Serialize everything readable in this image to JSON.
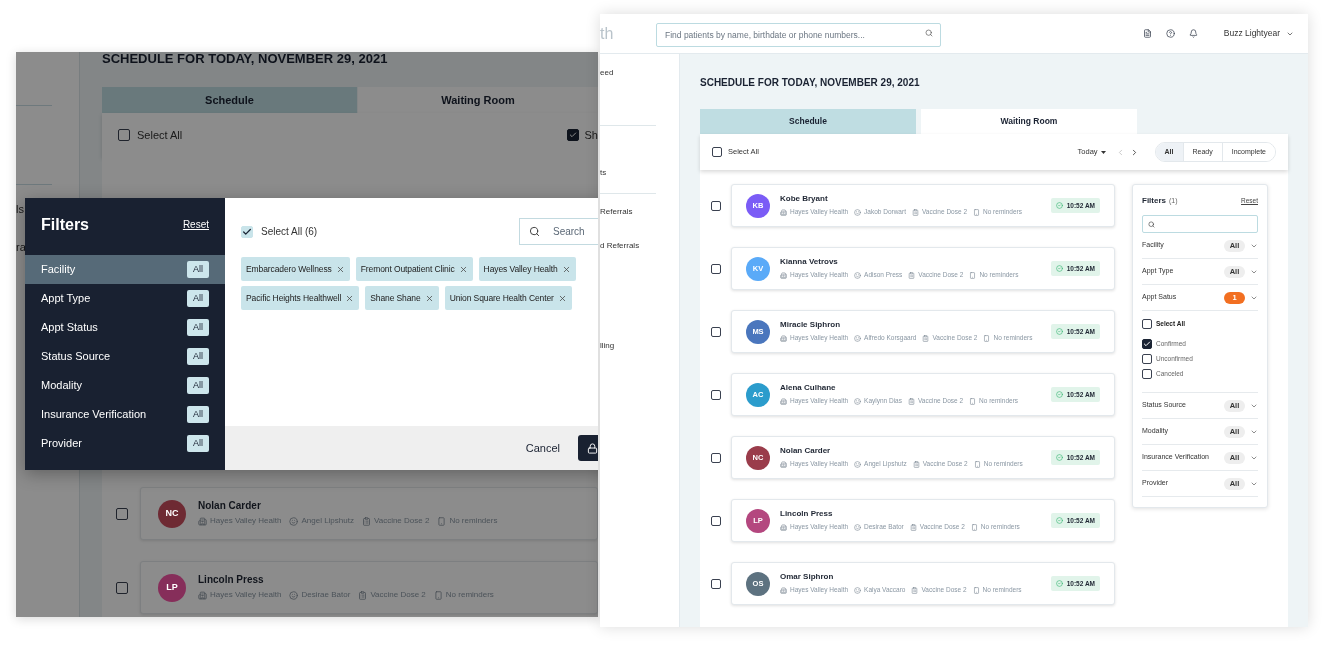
{
  "back_screen": {
    "sidebar_items": [
      "ls",
      "ra"
    ],
    "title": "SCHEDULE FOR TODAY, NOVEMBER 29, 2021",
    "tabs": [
      {
        "label": "Schedule",
        "selected": true
      },
      {
        "label": "Waiting Room",
        "selected": false
      }
    ],
    "select_all": {
      "label": "Select All",
      "checked": false
    },
    "show_toggle": {
      "label": "Sh",
      "checked": true
    },
    "appointments": [
      {
        "initials": "NC",
        "name": "Nolan Carder",
        "color": "#6e2a33",
        "checked": false,
        "facility": "Hayes Valley Health",
        "provider": "Angel Lipshutz",
        "type": "Vaccine Dose 2",
        "reminders": "No reminders"
      },
      {
        "initials": "LP",
        "name": "Lincoln Press",
        "color": "#862e5a",
        "checked": false,
        "facility": "Hayes Valley Health",
        "provider": "Desirae Bator",
        "type": "Vaccine Dose 2",
        "reminders": "No reminders"
      }
    ]
  },
  "filter_modal": {
    "title": "Filters",
    "reset": "Reset",
    "categories": [
      {
        "label": "Facility",
        "badge": "All",
        "selected": true
      },
      {
        "label": "Appt Type",
        "badge": "All",
        "selected": false
      },
      {
        "label": "Appt Status",
        "badge": "All",
        "selected": false
      },
      {
        "label": "Status Source",
        "badge": "All",
        "selected": false
      },
      {
        "label": "Modality",
        "badge": "All",
        "selected": false
      },
      {
        "label": "Insurance Verification",
        "badge": "All",
        "selected": false
      },
      {
        "label": "Provider",
        "badge": "All",
        "selected": false
      }
    ],
    "select_all": {
      "label": "Select All (6)",
      "checked": true
    },
    "search": {
      "placeholder": "Search"
    },
    "chips": [
      "Embarcadero Wellness",
      "Fremont Outpatient Clinic",
      "Hayes Valley Health",
      "Pacific Heights Healthwell",
      "Shane Shane",
      "Union Square Health Center"
    ],
    "cancel": "Cancel"
  },
  "app": {
    "logo": "th",
    "search": {
      "placeholder": "Find patients by name, birthdate or phone numbers..."
    },
    "user": "Buzz Lightyear",
    "sidebar_items": [
      "eed",
      "ts",
      "Referrals",
      "d Referrals",
      "lling"
    ],
    "title": "SCHEDULE FOR TODAY, NOVEMBER 29, 2021",
    "tabs": [
      {
        "label": "Schedule",
        "selected": true
      },
      {
        "label": "Waiting Room",
        "selected": false
      }
    ],
    "select_all": {
      "label": "Select All",
      "checked": false
    },
    "date": "Today",
    "segments": [
      {
        "label": "All",
        "selected": true
      },
      {
        "label": "Ready",
        "selected": false
      },
      {
        "label": "Incomplete",
        "selected": false
      }
    ],
    "appointments": [
      {
        "initials": "KB",
        "name": "Kobe Bryant",
        "color": "#7b5cf6",
        "checked": false,
        "facility": "Hayes Valley Health",
        "provider": "Jakob Dorwart",
        "type": "Vaccine Dose 2",
        "reminders": "No reminders",
        "time": "10:52 AM"
      },
      {
        "initials": "KV",
        "name": "Kianna Vetrovs",
        "color": "#5aaaf8",
        "checked": false,
        "facility": "Hayes Valley Health",
        "provider": "Adison Press",
        "type": "Vaccine Dose 2",
        "reminders": "No reminders",
        "time": "10:52 AM"
      },
      {
        "initials": "MS",
        "name": "Miracle Siphron",
        "color": "#4a76bd",
        "checked": false,
        "facility": "Hayes Valley Health",
        "provider": "Alfredo Korsgaard",
        "type": "Vaccine Dose 2",
        "reminders": "No reminders",
        "time": "10:52 AM"
      },
      {
        "initials": "AC",
        "name": "Alena Culhane",
        "color": "#2b9ccc",
        "checked": false,
        "facility": "Hayes Valley Health",
        "provider": "Kaylynn Dias",
        "type": "Vaccine Dose 2",
        "reminders": "No reminders",
        "time": "10:52 AM"
      },
      {
        "initials": "NC",
        "name": "Nolan Carder",
        "color": "#9a3c4b",
        "checked": false,
        "facility": "Hayes Valley Health",
        "provider": "Angel Lipshutz",
        "type": "Vaccine Dose 2",
        "reminders": "No reminders",
        "time": "10:52 AM"
      },
      {
        "initials": "LP",
        "name": "Lincoln Press",
        "color": "#b4477f",
        "checked": false,
        "facility": "Hayes Valley Health",
        "provider": "Desirae Bator",
        "type": "Vaccine Dose 2",
        "reminders": "No reminders",
        "time": "10:52 AM"
      },
      {
        "initials": "OS",
        "name": "Omar Siphron",
        "color": "#5d7280",
        "checked": false,
        "facility": "Hayes Valley Health",
        "provider": "Kaiya Vaccaro",
        "type": "Vaccine Dose 2",
        "reminders": "No reminders",
        "time": "10:52 AM"
      }
    ],
    "filters": {
      "title": "Filters",
      "count": "(1)",
      "reset": "Reset",
      "groups": [
        {
          "label": "Facility",
          "badge": "All",
          "active": false,
          "expanded": false
        },
        {
          "label": "Appt Type",
          "badge": "All",
          "active": false,
          "expanded": false
        },
        {
          "label": "Appt Satus",
          "badge": "1",
          "active": true,
          "expanded": true,
          "options": [
            {
              "label": "Select All",
              "checked": false
            },
            {
              "label": "Confirmed",
              "checked": true
            },
            {
              "label": "Unconfirmed",
              "checked": false
            },
            {
              "label": "Canceled",
              "checked": false
            }
          ]
        },
        {
          "label": "Status Source",
          "badge": "All",
          "active": false,
          "expanded": false
        },
        {
          "label": "Modality",
          "badge": "All",
          "active": false,
          "expanded": false
        },
        {
          "label": "Insurance Verification",
          "badge": "All",
          "active": false,
          "expanded": false
        },
        {
          "label": "Provider",
          "badge": "All",
          "active": false,
          "expanded": false
        }
      ]
    }
  }
}
